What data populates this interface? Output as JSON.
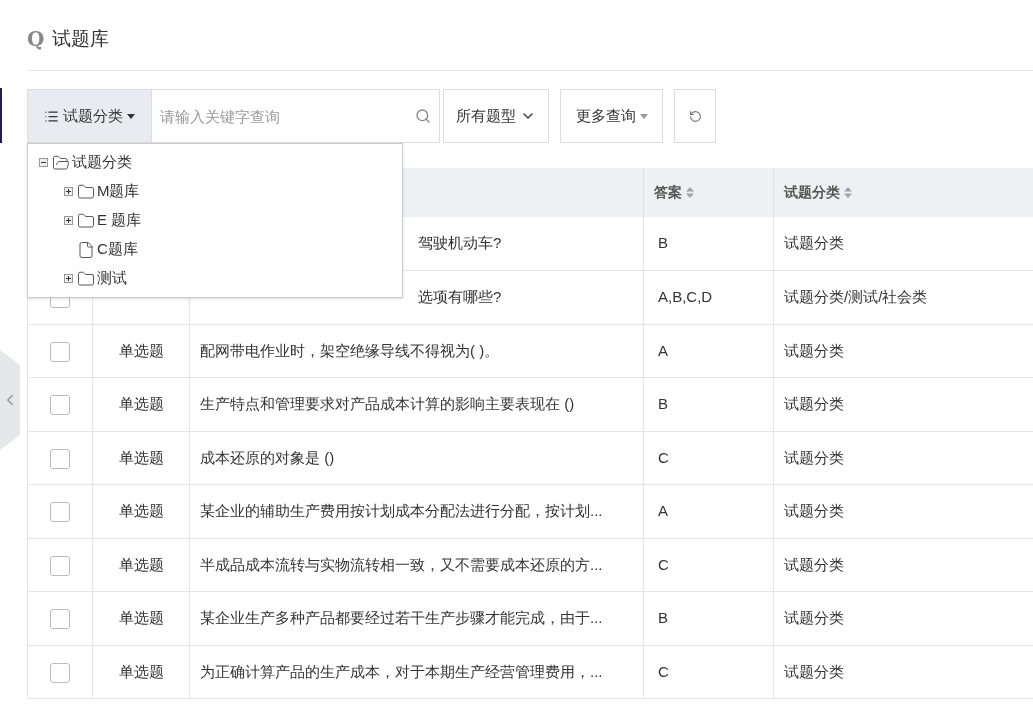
{
  "header": {
    "logo_letter": "Q",
    "title": "试题库"
  },
  "toolbar": {
    "category_button": "试题分类",
    "search": {
      "placeholder": "请输入关键字查询"
    },
    "type_select": "所有题型",
    "more_button": "更多查询"
  },
  "category_menu": {
    "expanded": true,
    "tree": [
      {
        "label": "试题分类",
        "kind": "folder",
        "expanded": true,
        "children": [
          {
            "label": "M题库",
            "kind": "folder",
            "expanded": false
          },
          {
            "label": "E 题库",
            "kind": "folder",
            "expanded": false
          },
          {
            "label": "C题库",
            "kind": "file"
          },
          {
            "label": "测试",
            "kind": "folder",
            "expanded": false
          }
        ]
      }
    ]
  },
  "table": {
    "columns": [
      {
        "label": "答案",
        "sortable": true
      },
      {
        "label": "试题分类",
        "sortable": true
      }
    ],
    "rows": [
      {
        "under_menu": true,
        "question": "驾驶机动车?",
        "answer": "B",
        "category": "试题分类"
      },
      {
        "under_menu": true,
        "checked": false,
        "question": "选项有哪些?",
        "answer": "A,B,C,D",
        "category": "试题分类/测试/社会类"
      },
      {
        "under_menu": false,
        "checked": false,
        "type": "单选题",
        "question": "配网带电作业时，架空绝缘导线不得视为( )。",
        "answer": "A",
        "category": "试题分类"
      },
      {
        "under_menu": false,
        "checked": false,
        "type": "单选题",
        "question": "生产特点和管理要求对产品成本计算的影响主要表现在 ()",
        "answer": "B",
        "category": "试题分类"
      },
      {
        "under_menu": false,
        "checked": false,
        "type": "单选题",
        "question": "成本还原的对象是 ()",
        "answer": "C",
        "category": "试题分类"
      },
      {
        "under_menu": false,
        "checked": false,
        "type": "单选题",
        "question": "某企业的辅助生产费用按计划成本分配法进行分配，按计划...",
        "answer": "A",
        "category": "试题分类"
      },
      {
        "under_menu": false,
        "checked": false,
        "type": "单选题",
        "question": "半成品成本流转与实物流转相一致，又不需要成本还原的方...",
        "answer": "C",
        "category": "试题分类"
      },
      {
        "under_menu": false,
        "checked": false,
        "type": "单选题",
        "question": "某企业生产多种产品都要经过若干生产步骤才能完成，由于...",
        "answer": "B",
        "category": "试题分类"
      },
      {
        "under_menu": false,
        "checked": false,
        "type": "单选题",
        "question": "为正确计算产品的生产成本，对于本期生产经营管理费用，...",
        "answer": "C",
        "category": "试题分类"
      }
    ]
  }
}
